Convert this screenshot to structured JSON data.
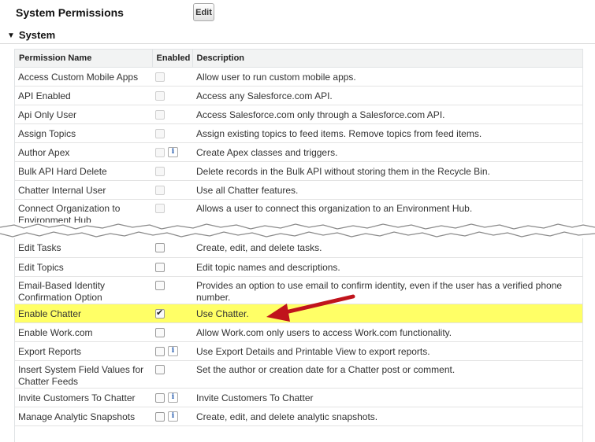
{
  "header": {
    "title": "System Permissions",
    "edit_label": "Edit"
  },
  "section": {
    "title": "System"
  },
  "columns": {
    "name": "Permission Name",
    "enabled": "Enabled",
    "description": "Description"
  },
  "rows_top": [
    {
      "name": [
        "Access Custom Mobile Apps"
      ],
      "enabled": false,
      "disabled": true,
      "info": false,
      "desc": [
        "Allow user to run custom mobile apps."
      ]
    },
    {
      "name": [
        "API Enabled"
      ],
      "enabled": false,
      "disabled": true,
      "info": false,
      "desc": [
        "Access any Salesforce.com API."
      ]
    },
    {
      "name": [
        "Api Only User"
      ],
      "enabled": false,
      "disabled": true,
      "info": false,
      "desc": [
        "Access Salesforce.com only through a Salesforce.com API."
      ]
    },
    {
      "name": [
        "Assign Topics"
      ],
      "enabled": false,
      "disabled": true,
      "info": false,
      "desc": [
        "Assign existing topics to feed items. Remove topics from feed items."
      ]
    },
    {
      "name": [
        "Author Apex"
      ],
      "enabled": false,
      "disabled": true,
      "info": true,
      "desc": [
        "Create Apex classes and triggers."
      ]
    },
    {
      "name": [
        "Bulk API Hard Delete"
      ],
      "enabled": false,
      "disabled": true,
      "info": false,
      "desc": [
        "Delete records in the Bulk API without storing them in the Recycle Bin."
      ]
    },
    {
      "name": [
        "Chatter Internal User"
      ],
      "enabled": false,
      "disabled": true,
      "info": false,
      "desc": [
        "Use all Chatter features."
      ]
    },
    {
      "name": [
        "Connect Organization to",
        "Environment Hub"
      ],
      "enabled": false,
      "disabled": true,
      "info": false,
      "desc": [
        "Allows a user to connect this organization to an Environment Hub."
      ]
    }
  ],
  "rows_bottom": [
    {
      "name": [
        "Edit Tasks"
      ],
      "enabled": false,
      "disabled": false,
      "info": false,
      "desc": [
        "Create, edit, and delete tasks."
      ]
    },
    {
      "name": [
        "Edit Topics"
      ],
      "enabled": false,
      "disabled": false,
      "info": false,
      "desc": [
        "Edit topic names and descriptions."
      ]
    },
    {
      "name": [
        "Email-Based Identity",
        "Confirmation Option"
      ],
      "enabled": false,
      "disabled": false,
      "info": false,
      "desc": [
        "Provides an option to use email to confirm identity, even if the user has a verified phone",
        "number."
      ]
    },
    {
      "name": [
        "Enable Chatter"
      ],
      "enabled": true,
      "disabled": false,
      "info": false,
      "highlight": true,
      "desc": [
        "Use Chatter."
      ]
    },
    {
      "name": [
        "Enable Work.com"
      ],
      "enabled": false,
      "disabled": false,
      "info": false,
      "desc": [
        "Allow Work.com only users to access Work.com functionality."
      ]
    },
    {
      "name": [
        "Export Reports"
      ],
      "enabled": false,
      "disabled": false,
      "info": true,
      "desc": [
        "Use Export Details and Printable View to export reports."
      ]
    },
    {
      "name": [
        "Insert System Field Values for",
        "Chatter Feeds"
      ],
      "enabled": false,
      "disabled": false,
      "info": false,
      "desc": [
        "Set the author or creation date for a Chatter post or comment."
      ]
    },
    {
      "name": [
        "Invite Customers To Chatter"
      ],
      "enabled": false,
      "disabled": false,
      "info": true,
      "desc": [
        "Invite Customers To Chatter"
      ]
    },
    {
      "name": [
        "Manage Analytic Snapshots"
      ],
      "enabled": false,
      "disabled": false,
      "info": true,
      "desc": [
        "Create, edit, and delete analytic snapshots."
      ]
    }
  ],
  "colors": {
    "highlight": "#ffff66",
    "arrow": "#c0141c",
    "info_icon": "#2a5fb0"
  },
  "icons": {
    "section_toggle": "triangle-down-icon",
    "info": "info-icon",
    "arrow": "red-arrow-icon"
  }
}
